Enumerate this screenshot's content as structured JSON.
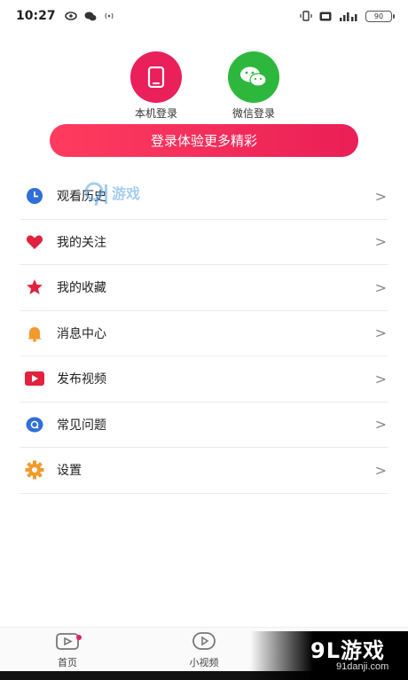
{
  "status_bar": {
    "time": "10:27",
    "battery": "90"
  },
  "login": {
    "local_label": "本机登录",
    "wechat_label": "微信登录",
    "main_button": "登录体验更多精彩"
  },
  "menu": {
    "items": [
      {
        "label": "观看历史",
        "icon": "clock-icon",
        "color": "#2f6fd8"
      },
      {
        "label": "我的关注",
        "icon": "heart-icon",
        "color": "#e1223f"
      },
      {
        "label": "我的收藏",
        "icon": "star-icon",
        "color": "#e1223f"
      },
      {
        "label": "消息中心",
        "icon": "bell-icon",
        "color": "#f19a2b"
      },
      {
        "label": "发布视频",
        "icon": "play-icon",
        "color": "#e1223f"
      },
      {
        "label": "常见问题",
        "icon": "question-icon",
        "color": "#2f6fd8"
      },
      {
        "label": "设置",
        "icon": "gear-icon",
        "color": "#f19a2b"
      }
    ],
    "chevron": ">"
  },
  "bottom_nav": {
    "home_label": "首页",
    "short_video_label": "小视频"
  },
  "watermark": {
    "list_text": "游戏",
    "brand": "9L游戏",
    "site": "91danji.com"
  },
  "colors": {
    "accent": "#e9205a",
    "wechat": "#2db83d"
  }
}
